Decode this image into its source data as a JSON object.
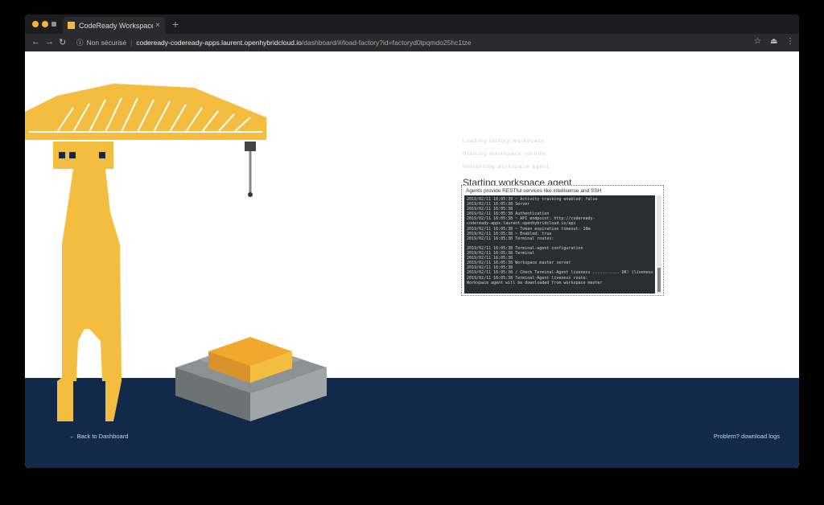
{
  "browser": {
    "tab_title": "CodeReady Workspaces | Load",
    "tab_close": "×",
    "new_tab": "+",
    "address": {
      "security_label": "Non sécurisé",
      "url_host": "codeready-codeready-apps.laurent.openhybridcloud.io",
      "url_path": "/dashboard/#/load-factory?id=factoryd0tpqmdo25hc1tze"
    },
    "icons": {
      "back": "←",
      "forward": "→",
      "reload": "↻",
      "star": "☆",
      "ext": "⏏",
      "menu": "⋮",
      "info": "ⓘ"
    }
  },
  "loader": {
    "completed_steps": [
      "Loading factory workspace",
      "Starting workspace runtime",
      "Initializing workspace agent"
    ],
    "current_step": "Starting workspace agent",
    "panel_title": "Agents provide RESTful services like intellisense and SSH",
    "log_lines": [
      "2019/02/11 16:05:39 ~ Activity tracking enabled: false",
      "2019/02/11 16:05:38 Server",
      "2019/02/11 16:05:38",
      "2019/02/11 16:05:38 Authentication",
      "2019/02/11 16:05:38 ~ API endpoint: http://codeready-",
      "codeready-apps.laurent.openhybridcloud.io/api",
      "2019/02/11 16:05:38 ~ Token expiration timeout: 10m",
      "2019/02/11 16:05:38 ~ Enabled: true",
      "2019/02/11 16:05:38 Terminal routes:",
      "",
      "2019/02/11 16:05:38 Terminal-agent configuration",
      "2019/02/11 16:05:38 Terminal",
      "2019/02/11 16:05:38",
      "2019/02/11 16:05:38 Workspace master server",
      "2019/02/11 16:05:38",
      "2019/02/11 16:05:38 / Check Terminal-Agent liveness ........... OK! (liveness",
      "2019/02/11 16:05:38 Terminal-Agent liveness route:",
      "Workspace agent will be downloaded from workspace master"
    ]
  },
  "footer": {
    "back_link": "← Back to Dashboard",
    "logs_link": "Problem? download logs"
  },
  "colors": {
    "crane": "#f5bd40",
    "footer": "#12294a",
    "terminal_bg": "#2b2e31",
    "block_grey": "#8b9293"
  }
}
